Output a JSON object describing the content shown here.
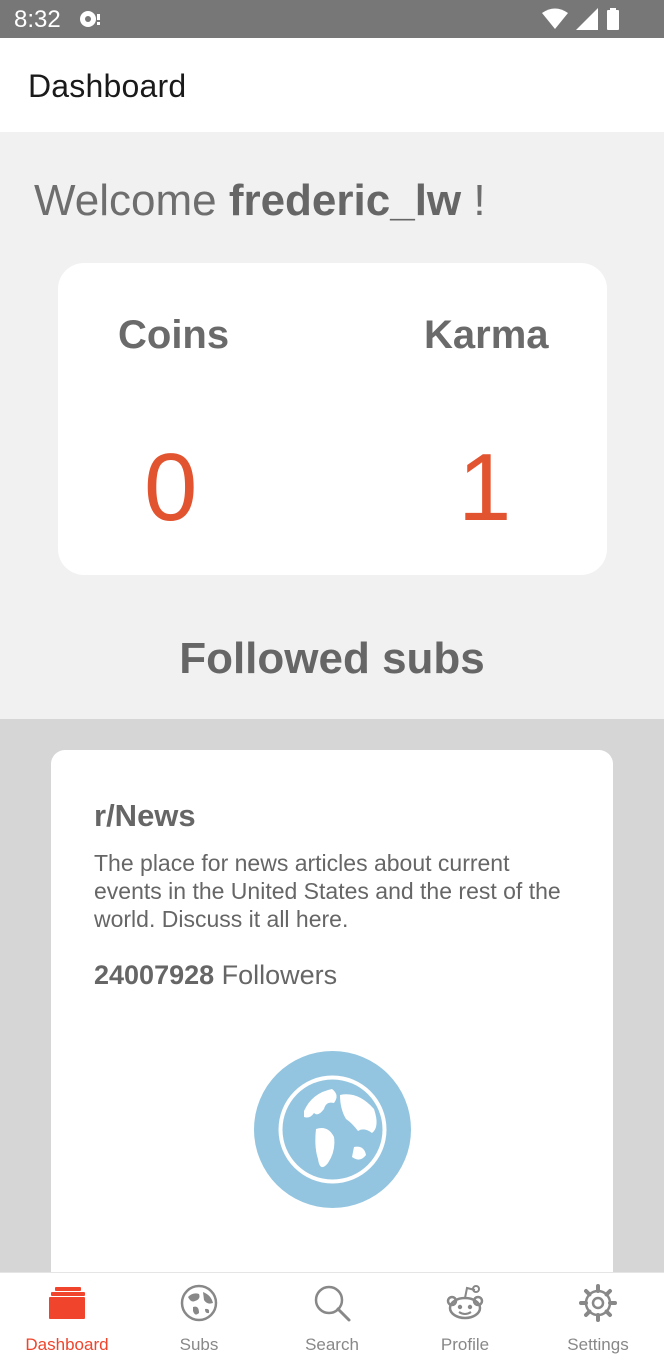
{
  "status_bar": {
    "time": "8:32"
  },
  "app_bar": {
    "title": "Dashboard"
  },
  "welcome": {
    "prefix": "Welcome ",
    "username": "frederic_lw",
    "suffix": " !"
  },
  "stats": {
    "coins_label": "Coins",
    "coins_value": "0",
    "karma_label": "Karma",
    "karma_value": "1"
  },
  "followed": {
    "title": "Followed subs",
    "subs": [
      {
        "name": "r/News",
        "description": "The place for news articles about current events in the United States and the rest of the world. Discuss it all here.",
        "followers_count": "24007928",
        "followers_label": " Followers",
        "icon": "globe-icon"
      }
    ]
  },
  "bottom_nav": {
    "items": [
      {
        "label": "Dashboard",
        "icon": "dashboard-icon",
        "active": true
      },
      {
        "label": "Subs",
        "icon": "globe-icon"
      },
      {
        "label": "Search",
        "icon": "search-icon"
      },
      {
        "label": "Profile",
        "icon": "reddit-alien-icon"
      },
      {
        "label": "Settings",
        "icon": "gear-icon"
      }
    ]
  },
  "colors": {
    "accent": "#f0442c",
    "stat_value": "#e2532f",
    "status_bar": "#777777",
    "globe": "#93c5e0"
  }
}
